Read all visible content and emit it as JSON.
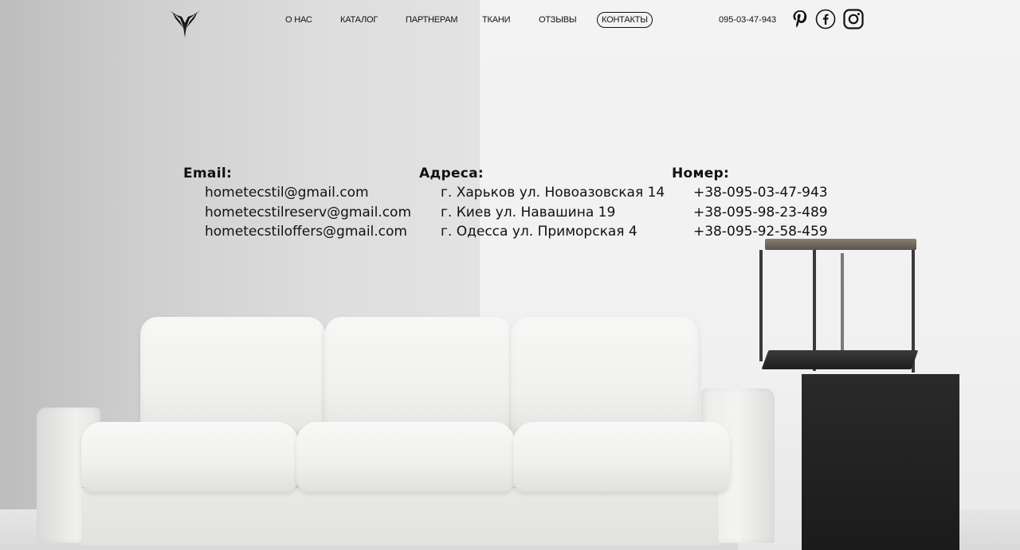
{
  "header": {
    "logo_icon": "bird-logo-icon",
    "nav": [
      {
        "label": "О НАС",
        "active": false
      },
      {
        "label": "КАТАЛОГ",
        "active": false
      },
      {
        "label": "ПАРТНЕРАМ",
        "active": false
      },
      {
        "label": "ТКАНИ",
        "active": false
      },
      {
        "label": "ОТЗЫВЫ",
        "active": false
      },
      {
        "label": "КОНТАКТЫ",
        "active": true
      }
    ],
    "phone": "095-03-47-943",
    "social": [
      "pinterest-icon",
      "facebook-icon",
      "instagram-icon"
    ]
  },
  "contacts": {
    "email": {
      "heading": "Email:",
      "items": [
        "hometecstil@gmail.com",
        "hometecstilreserv@gmail.com",
        "hometecstiloffers@gmail.com"
      ]
    },
    "addresses": {
      "heading": "Адреса:",
      "items": [
        "г. Харьков ул. Новоазовская 14",
        "г. Киев ул. Навашина 19",
        "г. Одесса ул. Приморская 4"
      ]
    },
    "phones": {
      "heading": "Номер:",
      "items": [
        "+38-095-03-47-943",
        "+38-095-98-23-489",
        "+38-095-92-58-459"
      ]
    }
  },
  "colors": {
    "text": "#111111",
    "wall_left": "#cfcfcf",
    "wall_right": "#f2f2f2",
    "pedestal": "#1e1e1e"
  }
}
